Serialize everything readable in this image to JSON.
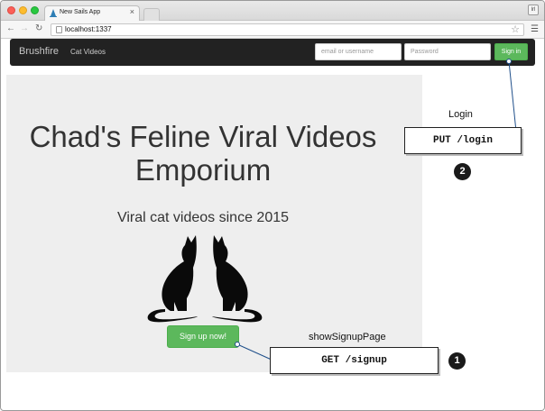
{
  "browser": {
    "tab_title": "New Sails App",
    "tab_close": "×",
    "url": "localhost:1337",
    "profile_label": "lrl",
    "back_icon": "arrow-left",
    "forward_icon": "arrow-right",
    "reload_icon": "reload",
    "star_icon": "star",
    "menu_icon": "hamburger"
  },
  "app_nav": {
    "brand": "Brushfire",
    "link_cat_videos": "Cat Videos",
    "email_placeholder": "email or username",
    "password_placeholder": "Password",
    "signin_label": "Sign in"
  },
  "jumbotron": {
    "headline_line1": "Chad's Feline Viral Videos",
    "headline_line2": "Emporium",
    "tagline": "Viral cat videos since 2015",
    "signup_label": "Sign up now!"
  },
  "annotations": {
    "login_label": "Login",
    "login_route": "PUT /login",
    "login_number": "2",
    "signup_label": "showSignupPage",
    "signup_route": "GET /signup",
    "signup_number": "1"
  },
  "colors": {
    "navbar_bg": "#222222",
    "jumbotron_bg": "#eeeeee",
    "button_green": "#5cb85c",
    "callout_line": "#1f4f8a"
  }
}
